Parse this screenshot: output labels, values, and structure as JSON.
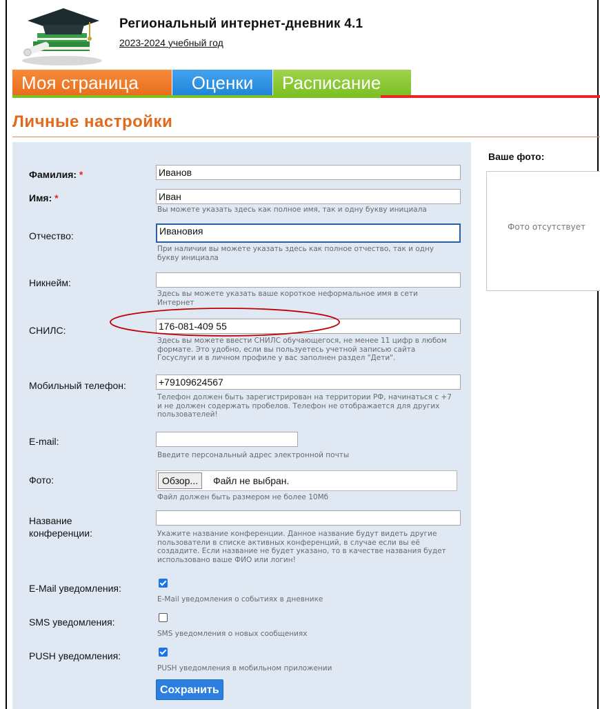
{
  "header": {
    "title": "Региональный интернет-дневник 4.1",
    "year": "2023-2024 учебный год"
  },
  "tabs": [
    {
      "label": "Моя страница",
      "color": "#e86d1b"
    },
    {
      "label": "Оценки",
      "color": "#1f84d9"
    },
    {
      "label": "Расписание",
      "color": "#7cc023"
    }
  ],
  "page_title": "Личные настройки",
  "form": {
    "surname": {
      "label": "Фамилия:",
      "required_mark": "*",
      "value": "Иванов"
    },
    "name": {
      "label": "Имя:",
      "required_mark": "*",
      "value": "Иван",
      "hint": "Вы можете указать здесь как полное имя, так и одну букву инициала"
    },
    "patronymic": {
      "label": "Отчество:",
      "value": "Ивановия",
      "hint": "При наличии вы можете указать здесь как полное отчество, так и одну букву инициала"
    },
    "nickname": {
      "label": "Никнейм:",
      "value": "",
      "hint": "Здесь вы можете указать ваше короткое неформальное имя в сети Интернет"
    },
    "snils": {
      "label": "СНИЛС:",
      "value": "176-081-409 55",
      "hint": "Здесь вы можете ввести СНИЛС обучающегося, не менее 11 цифр в любом формате. Это удобно, если вы пользуетесь учетной записью сайта Госуслуги и в личном профиле у вас заполнен раздел \"Дети\"."
    },
    "phone": {
      "label": "Мобильный телефон:",
      "value": "+79109624567",
      "hint": "Телефон должен быть зарегистрирован на территории РФ, начинаться с +7 и не должен содержать пробелов. Телефон не отображается для других пользователей!"
    },
    "email": {
      "label": "E-mail:",
      "value": "",
      "hint": "Введите персональный адрес электронной почты"
    },
    "photo": {
      "label": "Фото:",
      "browse_label": "Обзор...",
      "file_status": "Файл не выбран.",
      "hint": "Файл должен быть размером не более 10Мб"
    },
    "conference": {
      "label_line1": "Название",
      "label_line2": "конференции:",
      "value": "",
      "hint": "Укажите название конференции. Данное название будут видеть другие пользователи в списке активных конференций, в случае если вы её создадите. Если название не будет указано, то в качестве названия будет использовано ваше ФИО или логин!"
    },
    "email_notify": {
      "label": "E-Mail уведомления:",
      "checked": true,
      "hint": "E-Mail уведомления о событиях в дневнике"
    },
    "sms_notify": {
      "label": "SMS уведомления:",
      "checked": false,
      "hint": "SMS уведомления о новых сообщениях"
    },
    "push_notify": {
      "label": "PUSH уведомления:",
      "checked": true,
      "hint": "PUSH уведомления в мобильном приложении"
    },
    "save_label": "Сохранить"
  },
  "photo_panel": {
    "label": "Ваше фото:",
    "placeholder": "Фото отсутствует"
  },
  "colors": {
    "accent_orange": "#e26a1c",
    "panel_bg": "#dfe8f3",
    "button_blue": "#2b7fe0",
    "annotation_red": "#c00000"
  }
}
